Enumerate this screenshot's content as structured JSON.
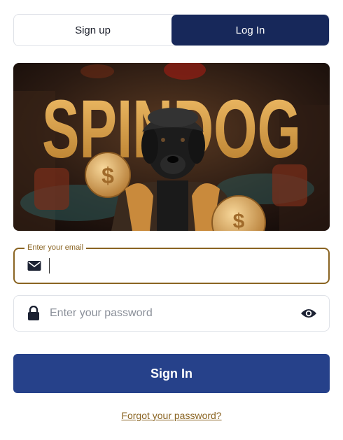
{
  "tabs": {
    "signup_label": "Sign up",
    "login_label": "Log In",
    "active": "login"
  },
  "banner": {
    "brand_text": "SPINDOG"
  },
  "email": {
    "legend": "Enter your email",
    "value": "",
    "icon": "envelope-icon"
  },
  "password": {
    "placeholder": "Enter your password",
    "value": "",
    "icon": "lock-icon",
    "toggle_icon": "eye-icon"
  },
  "submit": {
    "label": "Sign In"
  },
  "forgot": {
    "label": "Forgot your password?"
  },
  "colors": {
    "navy": "#17285a",
    "button_blue": "#26418a",
    "gold": "#8a6422",
    "banner_gold": "#e0a546"
  }
}
